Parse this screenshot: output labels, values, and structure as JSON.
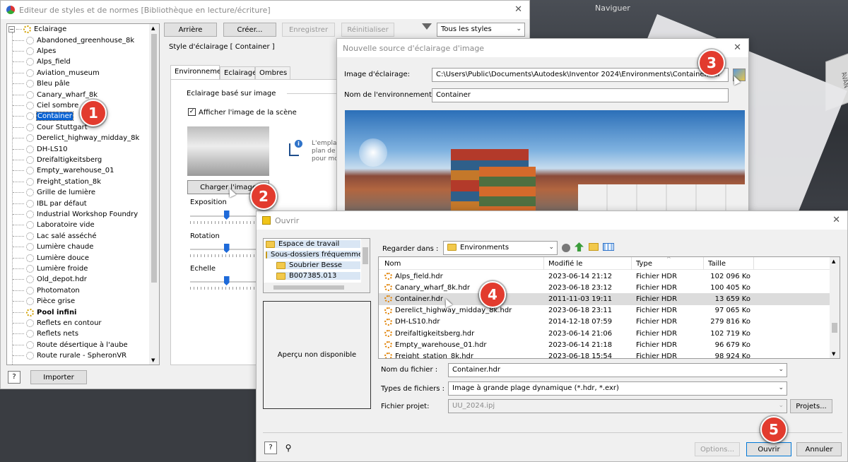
{
  "background": {
    "title": "Naviguer",
    "cube_text": "AVAN"
  },
  "editor": {
    "title": "Editeur de styles et de normes [Bibliothèque en lecture/écriture]",
    "tree": {
      "root": "Eclairage",
      "items": [
        {
          "label": "Abandoned_greenhouse_8k",
          "icon": "sun-outline"
        },
        {
          "label": "Alpes",
          "icon": "sun-outline"
        },
        {
          "label": "Alps_field",
          "icon": "sun-outline"
        },
        {
          "label": "Aviation_museum",
          "icon": "sun-outline"
        },
        {
          "label": "Bleu pâle",
          "icon": "sun-outline"
        },
        {
          "label": "Canary_wharf_8k",
          "icon": "sun-outline"
        },
        {
          "label": "Ciel sombre",
          "icon": "sun-outline"
        },
        {
          "label": "Container",
          "icon": "sun-outline",
          "selected": true
        },
        {
          "label": "Cour Stuttgart",
          "icon": "sun-outline"
        },
        {
          "label": "Derelict_highway_midday_8k",
          "icon": "sun-outline"
        },
        {
          "label": "DH-LS10",
          "icon": "sun-outline"
        },
        {
          "label": "Dreifaltigkeitsberg",
          "icon": "sun-outline"
        },
        {
          "label": "Empty_warehouse_01",
          "icon": "sun-outline"
        },
        {
          "label": "Freight_station_8k",
          "icon": "sun-outline"
        },
        {
          "label": "Grille de lumière",
          "icon": "sun-outline"
        },
        {
          "label": "IBL par défaut",
          "icon": "sun-outline"
        },
        {
          "label": "Industrial Workshop Foundry",
          "icon": "sun-outline"
        },
        {
          "label": "Laboratoire vide",
          "icon": "sun-outline"
        },
        {
          "label": "Lac salé asséché",
          "icon": "sun-outline"
        },
        {
          "label": "Lumière chaude",
          "icon": "sun-outline"
        },
        {
          "label": "Lumière douce",
          "icon": "sun-outline"
        },
        {
          "label": "Lumière froide",
          "icon": "sun-outline"
        },
        {
          "label": "Old_depot.hdr",
          "icon": "sun-outline"
        },
        {
          "label": "Photomaton",
          "icon": "sun-outline"
        },
        {
          "label": "Pièce grise",
          "icon": "sun-outline"
        },
        {
          "label": "Pool infini",
          "icon": "sun-gold",
          "bold": true
        },
        {
          "label": "Reflets en contour",
          "icon": "sun-outline"
        },
        {
          "label": "Reflets nets",
          "icon": "sun-outline"
        },
        {
          "label": "Route désertique à l'aube",
          "icon": "sun-outline"
        },
        {
          "label": "Route rurale - SpheronVR",
          "icon": "sun-outline"
        }
      ]
    },
    "buttons": {
      "back": "Arrière",
      "create": "Créer...",
      "save": "Enregistrer",
      "reset": "Réinitialiser",
      "import": "Importer"
    },
    "filter": "Tous les styles",
    "style_header": "Style d'éclairage [ Container ]",
    "tabs": [
      "Environnement",
      "Eclairage",
      "Ombres"
    ],
    "ibl_label": "Eclairage basé sur image",
    "show_image_label": "Afficher l'image de la scène",
    "info_text": [
      "L'emplace",
      "plan de s",
      "pour mod"
    ],
    "load_image": "Charger l'image",
    "exposure": "Exposition",
    "rotation": "Rotation",
    "scale": "Echelle",
    "exposure_value": 0.46,
    "rotation_value": 0.46,
    "scale_value": 0.46
  },
  "source_dialog": {
    "title": "Nouvelle source d'éclairage d'image",
    "image_label": "Image d'éclairage:",
    "image_path": "C:\\Users\\Public\\Documents\\Autodesk\\Inventor 2024\\Environments\\Container.hdr",
    "env_label": "Nom de l'environnement:",
    "env_name": "Container"
  },
  "open_dialog": {
    "title": "Ouvrir",
    "places": [
      "Espace de travail",
      "Sous-dossiers fréquemme",
      "Soubrier Besse",
      "B007385.013"
    ],
    "preview": "Aperçu non disponible",
    "look_in_label": "Regarder dans :",
    "look_in": "Environments",
    "columns": {
      "name": "Nom",
      "modified": "Modifié le",
      "type": "Type",
      "size": "Taille"
    },
    "files": [
      {
        "name": "Alps_field.hdr",
        "modified": "2023-06-14 21:12",
        "type": "Fichier HDR",
        "size": "102 096 Ko"
      },
      {
        "name": "Canary_wharf_8k.hdr",
        "modified": "2023-06-18 23:12",
        "type": "Fichier HDR",
        "size": "100 405 Ko"
      },
      {
        "name": "Container.hdr",
        "modified": "2011-11-03 19:11",
        "type": "Fichier HDR",
        "size": "13 659 Ko",
        "selected": true
      },
      {
        "name": "Derelict_highway_midday_8k.hdr",
        "modified": "2023-06-18 23:11",
        "type": "Fichier HDR",
        "size": "97 065 Ko"
      },
      {
        "name": "DH-LS10.hdr",
        "modified": "2014-12-18 07:59",
        "type": "Fichier HDR",
        "size": "279 816 Ko"
      },
      {
        "name": "Dreifaltigkeitsberg.hdr",
        "modified": "2023-06-14 21:06",
        "type": "Fichier HDR",
        "size": "102 719 Ko"
      },
      {
        "name": "Empty_warehouse_01.hdr",
        "modified": "2023-06-14 21:18",
        "type": "Fichier HDR",
        "size": "96 679 Ko"
      },
      {
        "name": "Freight_station_8k.hdr",
        "modified": "2023-06-18 15:54",
        "type": "Fichier HDR",
        "size": "98 924 Ko"
      }
    ],
    "filename_label": "Nom du fichier :",
    "filename": "Container.hdr",
    "filetype_label": "Types de fichiers :",
    "filetype": "Image à grande plage dynamique (*.hdr, *.exr)",
    "project_label": "Fichier projet:",
    "project": "UU_2024.ipj",
    "projects_btn": "Projets...",
    "options": "Options...",
    "open": "Ouvrir",
    "cancel": "Annuler"
  },
  "steps": [
    "1",
    "2",
    "3",
    "4",
    "5"
  ],
  "colors": {
    "badge": "#e23b2e",
    "selection": "#0a63d4"
  }
}
